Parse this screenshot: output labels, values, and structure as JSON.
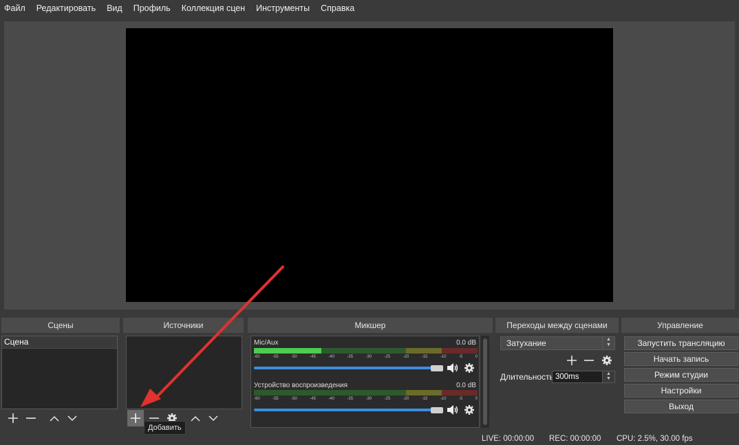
{
  "menu": [
    "Файл",
    "Редактировать",
    "Вид",
    "Профиль",
    "Коллекция сцен",
    "Инструменты",
    "Справка"
  ],
  "docks": {
    "scenes": "Сцены",
    "sources": "Источники",
    "mixer": "Микшер",
    "transitions": "Переходы между сценами",
    "controls": "Управление"
  },
  "scenes": {
    "items": [
      "Сцена"
    ]
  },
  "sources": {
    "tooltip": "Добавить"
  },
  "mixer": {
    "scale": [
      "-60",
      "-55",
      "-50",
      "-45",
      "-40",
      "-35",
      "-30",
      "-25",
      "-20",
      "-15",
      "-10",
      "-5",
      "0"
    ],
    "channels": [
      {
        "name": "Mic/Aux",
        "db": "0.0 dB",
        "level": 0.3,
        "volume": 1.0
      },
      {
        "name": "Устройство воспроизведения",
        "db": "0.0 dB",
        "level": 0.0,
        "volume": 1.0
      }
    ]
  },
  "transitions": {
    "selected": "Затухание",
    "duration_label": "Длительность",
    "duration_value": "300ms"
  },
  "controls": {
    "buttons": [
      "Запустить трансляцию",
      "Начать запись",
      "Режим студии",
      "Настройки",
      "Выход"
    ]
  },
  "status": {
    "live": "LIVE: 00:00:00",
    "rec": "REC: 00:00:00",
    "cpu": "CPU: 2.5%, 30.00 fps"
  },
  "colors": {
    "annotation_arrow": "#e0322e",
    "volume_slider": "#3d8ee0"
  }
}
